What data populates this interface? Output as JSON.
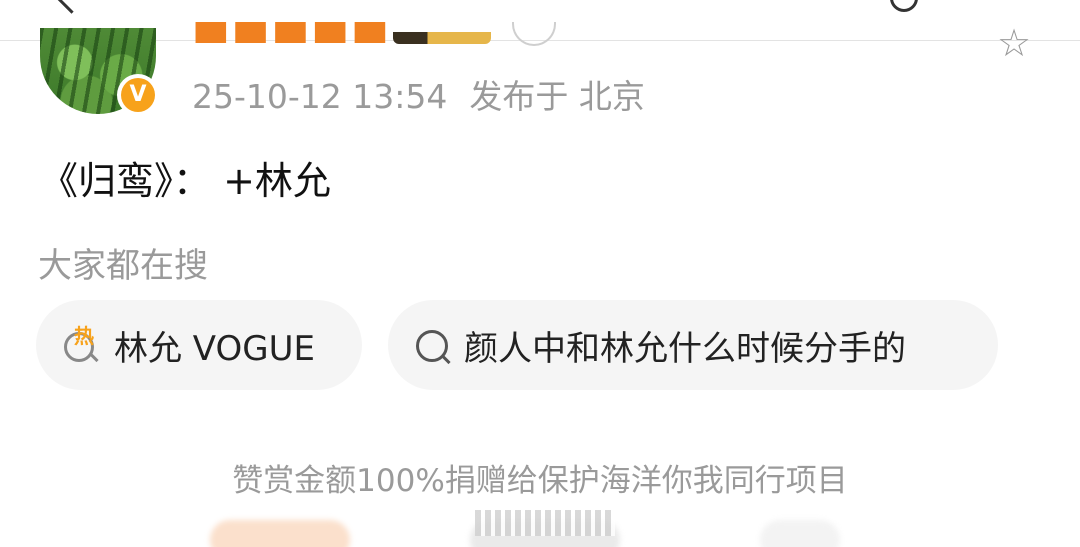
{
  "post": {
    "author": {
      "name": "",
      "verified": true,
      "badge_color": "#f7a21b",
      "avatar": "watermelon-avatar"
    },
    "timestamp": "25-10-12 13:54",
    "location": "发布于 北京",
    "text": "《归鸾》： +林允"
  },
  "related_search": {
    "title": "大家都在搜",
    "chips": [
      {
        "icon": "hot-search-icon",
        "label": "林允 VOGUE"
      },
      {
        "icon": "search-icon",
        "label": "颜人中和林允什么时候分手的"
      }
    ]
  },
  "reward": {
    "text": "赞赏金额100%捐赠给保护海洋你我同行项目"
  },
  "colors": {
    "accent": "#f7a21b",
    "muted_text": "#9a9a9a",
    "chip_bg": "#f5f5f5"
  }
}
